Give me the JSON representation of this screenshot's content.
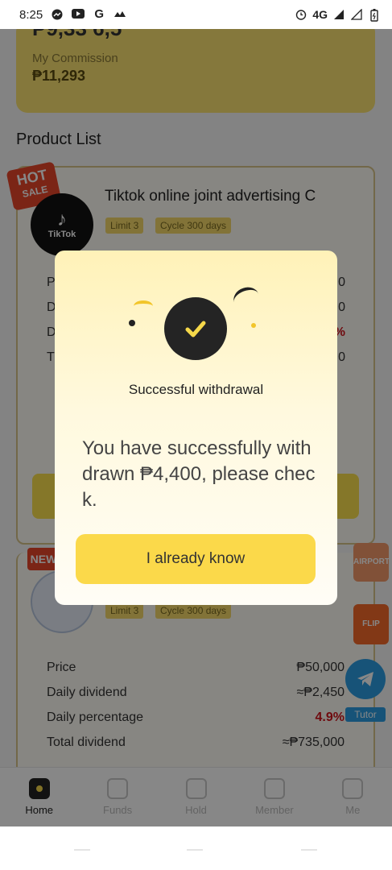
{
  "status_bar": {
    "time": "8:25",
    "notification_icons": [
      "messenger-icon",
      "youtube-icon",
      "google-icon",
      "wave-icon"
    ],
    "alarm_icon": "alarm-icon",
    "network": "4G",
    "signal_icons": [
      "signal-icon",
      "signal-icon",
      "battery-icon"
    ]
  },
  "commission": {
    "total_partial": "₱9,33 6,5",
    "label": "My Commission",
    "value": "₱11,293"
  },
  "product_list": {
    "title": "Product List",
    "products": [
      {
        "badge": "HOT",
        "badge_sub": "SALE",
        "logo_text": "TikTok",
        "name": "Tiktok online joint advertising C",
        "tags": [
          "Limit 3",
          "Cycle 300 days"
        ],
        "row_stubs": [
          "P",
          "D",
          "D",
          "T"
        ],
        "row_values": [
          "0",
          "0",
          "%",
          "0"
        ]
      },
      {
        "badge": "NEW",
        "tags": [
          "Limit 3",
          "Cycle 300 days"
        ],
        "specs": [
          {
            "label": "Price",
            "value": "₱50,000"
          },
          {
            "label": "Daily dividend",
            "value": "≈₱2,450"
          },
          {
            "label": "Daily percentage",
            "value": "4.9%"
          },
          {
            "label": "Total dividend",
            "value": "≈₱735,000"
          }
        ]
      }
    ]
  },
  "side": {
    "telegram_icon": "telegram-icon",
    "tutor_label": "Tutor",
    "ad1_label": "AIRPORT",
    "ad2_label": "FLIP"
  },
  "tabbar": {
    "tabs": [
      {
        "label": "Home",
        "icon": "home-icon",
        "active": true
      },
      {
        "label": "Funds",
        "icon": "funds-icon",
        "active": false
      },
      {
        "label": "Hold",
        "icon": "hold-icon",
        "active": false
      },
      {
        "label": "Member",
        "icon": "member-icon",
        "active": false
      },
      {
        "label": "Me",
        "icon": "me-icon",
        "active": false
      }
    ]
  },
  "modal": {
    "icon": "check-icon",
    "title": "Successful withdrawal",
    "message": "You have successfully withdrawn ₱4,400, please check.",
    "button_label": "I already know"
  },
  "colors": {
    "accent_yellow": "#fbd94a",
    "dark": "#242424",
    "red_value": "#d2131c",
    "overlay": "rgba(0,0,0,0.47)"
  }
}
